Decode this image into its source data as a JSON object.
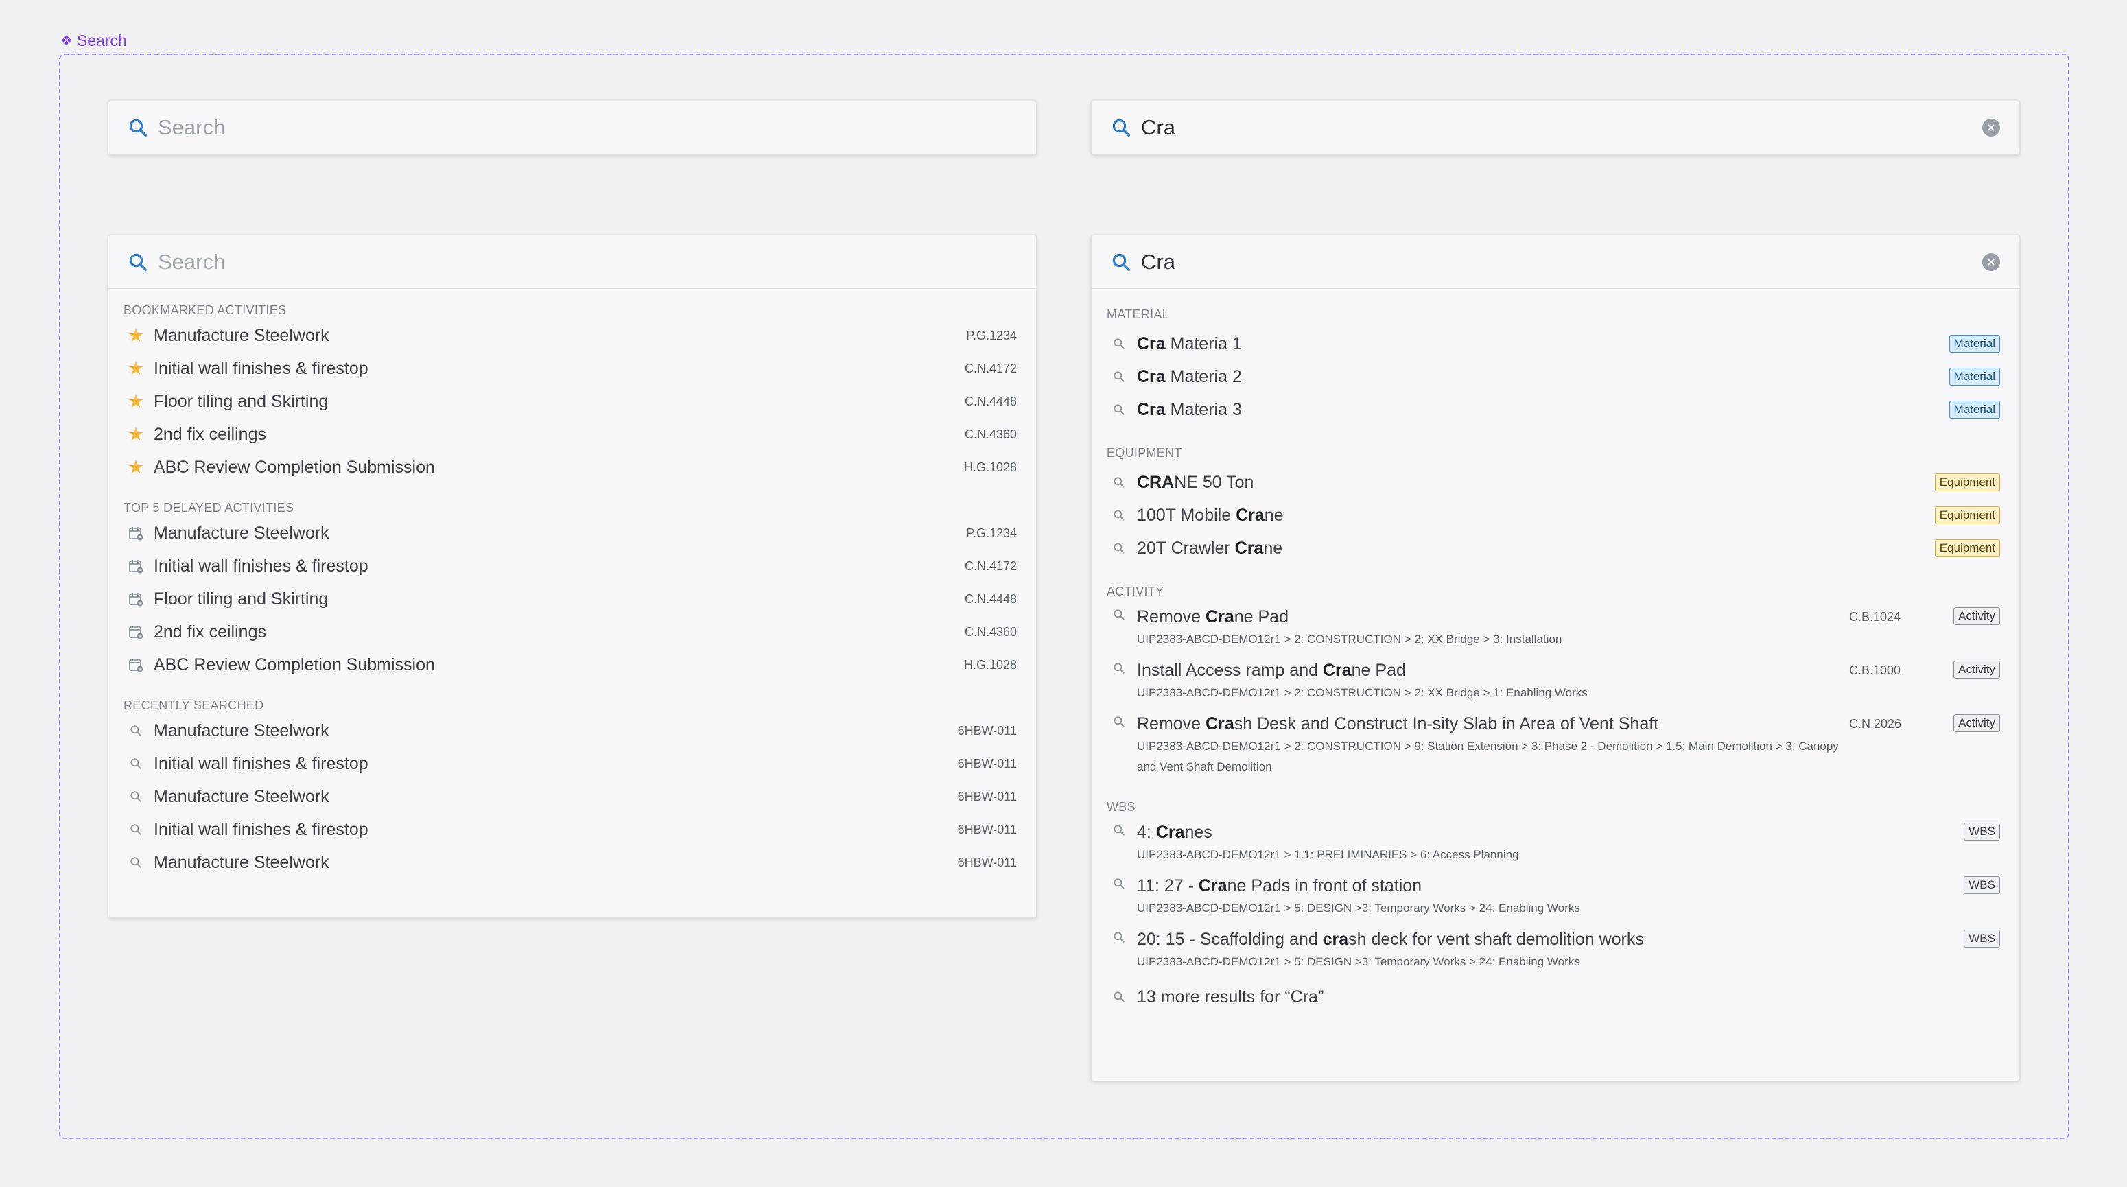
{
  "frame": {
    "label": "Search"
  },
  "panel_empty": {
    "placeholder": "Search"
  },
  "panel_typed": {
    "value": "Cra"
  },
  "panel_dropdown_empty": {
    "placeholder": "Search",
    "sections": [
      {
        "title": "BOOKMARKED ACTIVITIES",
        "icon": "star-icon",
        "items": [
          {
            "label": "Manufacture Steelwork",
            "code": "P.G.1234"
          },
          {
            "label": "Initial wall finishes & firestop",
            "code": "C.N.4172"
          },
          {
            "label": "Floor tiling and Skirting",
            "code": "C.N.4448"
          },
          {
            "label": "2nd fix ceilings",
            "code": "C.N.4360"
          },
          {
            "label": "ABC Review Completion Submission",
            "code": "H.G.1028"
          }
        ]
      },
      {
        "title": "TOP 5 DELAYED ACTIVITIES",
        "icon": "calendar-clock-icon",
        "items": [
          {
            "label": "Manufacture Steelwork",
            "code": "P.G.1234"
          },
          {
            "label": "Initial wall finishes & firestop",
            "code": "C.N.4172"
          },
          {
            "label": "Floor tiling and Skirting",
            "code": "C.N.4448"
          },
          {
            "label": "2nd fix ceilings",
            "code": "C.N.4360"
          },
          {
            "label": "ABC Review Completion Submission",
            "code": "H.G.1028"
          }
        ]
      },
      {
        "title": "RECENTLY SEARCHED",
        "icon": "search-icon",
        "items": [
          {
            "label": "Manufacture Steelwork",
            "code": "6HBW-011"
          },
          {
            "label": "Initial wall finishes & firestop",
            "code": "6HBW-011"
          },
          {
            "label": "Manufacture Steelwork",
            "code": "6HBW-011"
          },
          {
            "label": "Initial wall finishes & firestop",
            "code": "6HBW-011"
          },
          {
            "label": "Manufacture Steelwork",
            "code": "6HBW-011"
          }
        ]
      }
    ]
  },
  "panel_dropdown_results": {
    "value": "Cra",
    "material": {
      "title": "MATERIAL",
      "items": [
        {
          "pre": "",
          "bold": "Cra",
          "post": " Materia 1",
          "tag": "Material"
        },
        {
          "pre": "",
          "bold": "Cra",
          "post": " Materia 2",
          "tag": "Material"
        },
        {
          "pre": "",
          "bold": "Cra",
          "post": " Materia 3",
          "tag": "Material"
        }
      ]
    },
    "equipment": {
      "title": "EQUIPMENT",
      "items": [
        {
          "pre": "",
          "bold": "CRA",
          "post": "NE 50 Ton",
          "tag": "Equipment"
        },
        {
          "pre": "100T Mobile ",
          "bold": "Cra",
          "post": "ne",
          "tag": "Equipment"
        },
        {
          "pre": "20T Crawler ",
          "bold": "Cra",
          "post": "ne",
          "tag": "Equipment"
        }
      ]
    },
    "activity": {
      "title": "ACTIVITY",
      "items": [
        {
          "pre": "Remove ",
          "bold": "Cra",
          "post": "ne Pad",
          "code": "C.B.1024",
          "tag": "Activity",
          "path": "UIP2383-ABCD-DEMO12r1 > 2: CONSTRUCTION > 2: XX Bridge > 3: Installation"
        },
        {
          "pre": "Install Access ramp and ",
          "bold": "Cra",
          "post": "ne Pad",
          "code": "C.B.1000",
          "tag": "Activity",
          "path": "UIP2383-ABCD-DEMO12r1 > 2: CONSTRUCTION > 2: XX Bridge > 1: Enabling Works"
        },
        {
          "pre": "Remove ",
          "bold": "Cra",
          "post": "sh Desk and Construct In-sity Slab in Area of Vent Shaft",
          "code": "C.N.2026",
          "tag": "Activity",
          "path": "UIP2383-ABCD-DEMO12r1 > 2: CONSTRUCTION > 9: Station Extension > 3: Phase 2 - Demolition > 1.5: Main Demolition > 3: Canopy and Vent Shaft Demolition"
        }
      ]
    },
    "wbs": {
      "title": "WBS",
      "items": [
        {
          "pre": "4: ",
          "bold": "Cra",
          "post": "nes",
          "tag": "WBS",
          "path": "UIP2383-ABCD-DEMO12r1 > 1.1: PRELIMINARIES > 6: Access Planning"
        },
        {
          "pre": "11: 27 - ",
          "bold": "Cra",
          "post": "ne Pads in front of station",
          "tag": "WBS",
          "path": "UIP2383-ABCD-DEMO12r1 > 5: DESIGN >3: Temporary Works > 24: Enabling Works"
        },
        {
          "pre": "20: 15 - Scaffolding and ",
          "bold": "cra",
          "post": "sh deck for vent shaft demolition works",
          "tag": "WBS",
          "path": "UIP2383-ABCD-DEMO12r1 > 5: DESIGN >3: Temporary Works > 24: Enabling Works"
        }
      ]
    },
    "more_results": "13 more results for “Cra”"
  }
}
